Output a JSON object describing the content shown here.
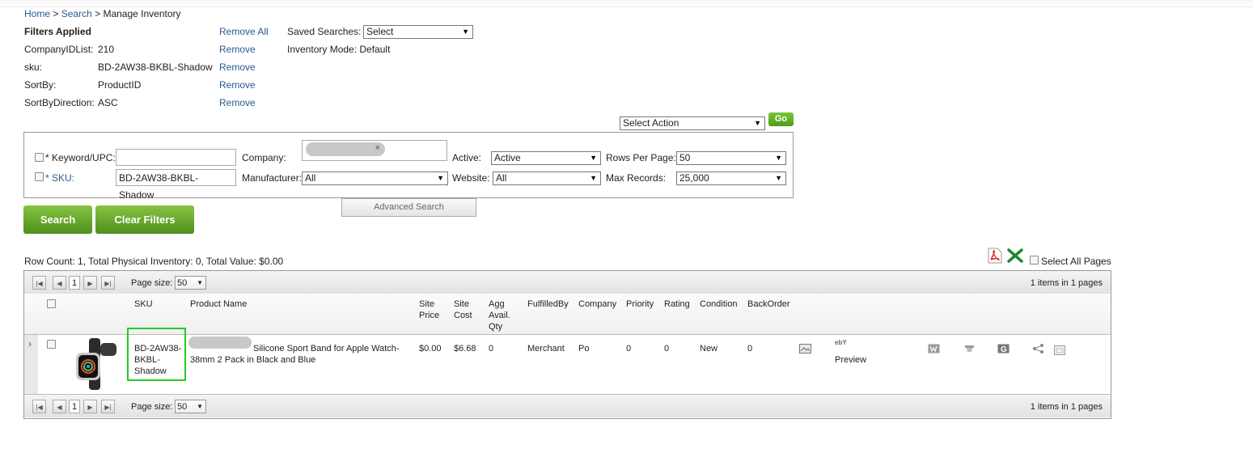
{
  "breadcrumb": {
    "home": "Home",
    "search": "Search",
    "current": "Manage Inventory",
    "sep": ">"
  },
  "filters": {
    "title": "Filters Applied",
    "remove_all": "Remove All",
    "items": [
      {
        "label": "CompanyIDList:",
        "value": "210",
        "action": "Remove"
      },
      {
        "label": "sku:",
        "value": "BD-2AW38-BKBL-Shadow",
        "action": "Remove"
      },
      {
        "label": "SortBy:",
        "value": "ProductID",
        "action": "Remove"
      },
      {
        "label": "SortByDirection:",
        "value": "ASC",
        "action": "Remove"
      }
    ]
  },
  "saved_searches": {
    "label": "Saved Searches:",
    "value": "Select"
  },
  "inventory_mode": "Inventory Mode: Default",
  "action": {
    "select": "Select Action",
    "go": "Go"
  },
  "search_form": {
    "keyword_label": "* Keyword/UPC:",
    "keyword_value": "",
    "sku_label": "* SKU:",
    "sku_value": "BD-2AW38-BKBL-Shadow",
    "company_label": "Company:",
    "company_chip_close": "×",
    "manufacturer_label": "Manufacturer:",
    "manufacturer_value": "All",
    "active_label": "Active:",
    "active_value": "Active",
    "website_label": "Website:",
    "website_value": "All",
    "rows_label": "Rows Per Page:",
    "rows_value": "50",
    "max_label": "Max Records:",
    "max_value": "25,000",
    "advanced": "Advanced Search"
  },
  "buttons": {
    "search": "Search",
    "clear": "Clear Filters"
  },
  "summary": "Row Count: 1, Total Physical Inventory: 0, Total Value: $0.00",
  "select_all_pages": "Select All Pages",
  "pager": {
    "page": "1",
    "size_label": "Page size:",
    "size": "50",
    "info": "1 items in 1 pages"
  },
  "columns": [
    "SKU",
    "Product Name",
    "Site Price",
    "Site Cost",
    "Agg Avail. Qty",
    "FulfilledBy",
    "Company",
    "Priority",
    "Rating",
    "Condition",
    "BackOrder"
  ],
  "row": {
    "sku": "BD-2AW38-BKBL-Shadow",
    "product_name": "Silicone Sport Band for Apple Watch- 38mm 2 Pack in Black and Blue",
    "site_price": "$0.00",
    "site_cost": "$6.68",
    "agg_qty": "0",
    "fulfilled_by": "Merchant",
    "company": "Po",
    "priority": "0",
    "rating": "0",
    "condition": "New",
    "backorder": "0",
    "preview": "Preview",
    "ebay_label": "ebY"
  },
  "colors": {
    "link": "#2a5a8f",
    "green_button": "#5aa324",
    "highlight": "#22cc22"
  }
}
